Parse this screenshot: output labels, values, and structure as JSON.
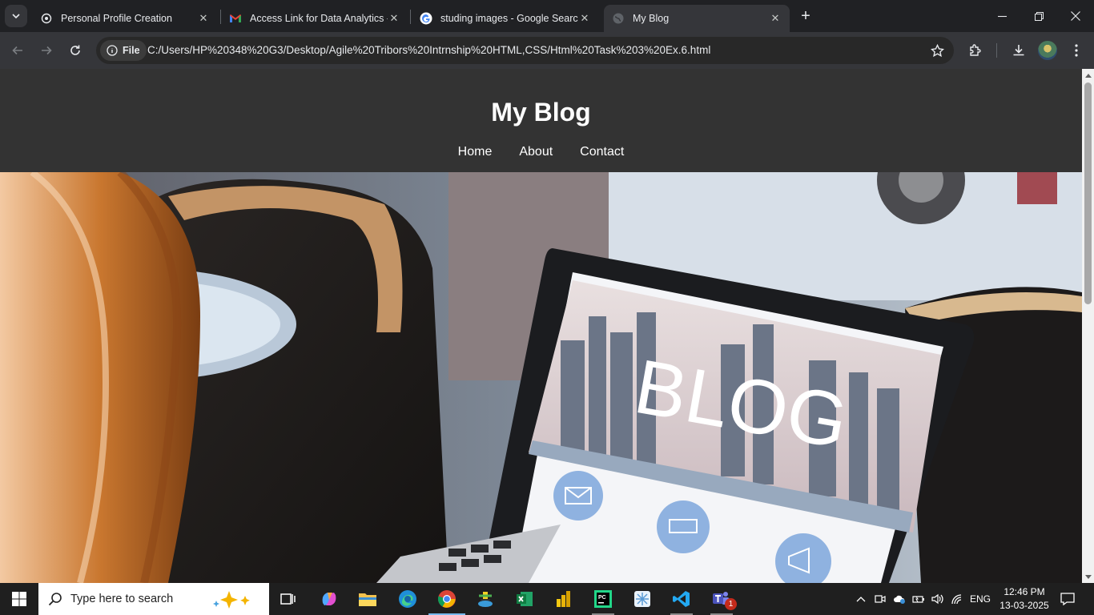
{
  "browser": {
    "tabs": [
      {
        "title": "Personal Profile Creation",
        "icon": "openai-favicon-icon",
        "active": false
      },
      {
        "title": "Access Link for Data Analytics -",
        "icon": "gmail-favicon-icon",
        "active": false
      },
      {
        "title": "studing images - Google Search",
        "icon": "google-favicon-icon",
        "active": false
      },
      {
        "title": "My Blog",
        "icon": "globe-favicon-icon",
        "active": true
      }
    ],
    "address": {
      "chip_label": "File",
      "url": "C:/Users/HP%20348%20G3/Desktop/Agile%20Tribors%20Intrnship%20HTML,CSS/Html%20Task%203%20Ex.6.html"
    }
  },
  "page": {
    "site_title": "My Blog",
    "nav": [
      "Home",
      "About",
      "Contact"
    ],
    "hero_image": {
      "screen_text": "BLOG"
    }
  },
  "taskbar": {
    "search_placeholder": "Type here to search",
    "apps": [
      "task-view-icon",
      "copilot-icon",
      "file-explorer-icon",
      "edge-icon",
      "chrome-icon",
      "installer-icon",
      "excel-icon",
      "power-bi-icon",
      "pycharm-icon",
      "snipping-icon",
      "vscode-icon",
      "teams-icon"
    ],
    "teams_badge": "1",
    "language": "ENG",
    "time": "12:46 PM",
    "date": "13-03-2025"
  },
  "colors": {
    "site_header_bg": "#333333",
    "browser_frame": "#202124",
    "toolbar": "#35363a",
    "accent": "#76b9ed"
  }
}
